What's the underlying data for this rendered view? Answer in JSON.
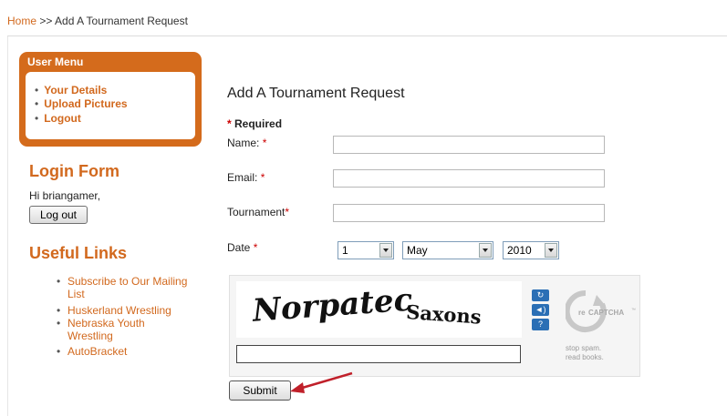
{
  "breadcrumb": {
    "home": "Home",
    "separator": ">>",
    "current": "Add A Tournament Request"
  },
  "user_menu": {
    "title": "User Menu",
    "items": [
      {
        "label": "Your Details"
      },
      {
        "label": "Upload Pictures"
      },
      {
        "label": "Logout"
      }
    ]
  },
  "login": {
    "heading": "Login Form",
    "greeting": "Hi briangamer,",
    "logout_label": "Log out"
  },
  "useful_links": {
    "heading": "Useful Links",
    "items": [
      {
        "line1": "Subscribe to Our Mailing",
        "line2": "List"
      },
      {
        "line1": "Huskerland Wrestling",
        "line2": ""
      },
      {
        "line1": "Nebraska Youth",
        "line2": "Wrestling"
      },
      {
        "line1": "AutoBracket",
        "line2": ""
      }
    ]
  },
  "form": {
    "title": "Add A Tournament Request",
    "required_note": "Required",
    "star": "*",
    "name_label": "Name:",
    "name_value": "",
    "email_label": "Email:",
    "email_value": "",
    "tournament_label": "Tournament",
    "tournament_value": "",
    "date_label": "Date",
    "date_day": "1",
    "date_month": "May",
    "date_year": "2010",
    "submit_label": "Submit"
  },
  "captcha": {
    "word1": "Norpatec",
    "word2": "Saxons",
    "logo_prefix": "re",
    "logo_text": "CAPTCHA",
    "logo_tm": "™",
    "tag_line1": "stop spam.",
    "tag_line2": "read books.",
    "response_value": ""
  },
  "colors": {
    "accent": "#d2691e",
    "menu_bg": "#d46b1c",
    "required": "#cc0000",
    "captcha_blue": "#2b6fb5",
    "arrow": "#c0202a"
  },
  "icons": {
    "refresh": "refresh-icon",
    "audio": "audio-icon",
    "help": "help-icon",
    "pointer": "red-arrow-icon"
  }
}
